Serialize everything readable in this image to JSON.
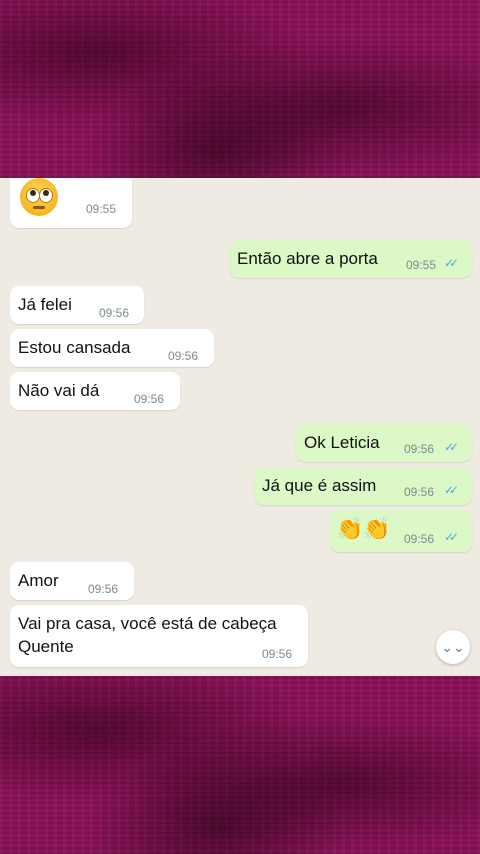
{
  "messages": [
    {
      "dir": "in",
      "text": "",
      "emoji": "rolling-eyes",
      "time": "09:55"
    },
    {
      "dir": "out",
      "text": "Então abre a porta",
      "time": "09:55"
    },
    {
      "dir": "in",
      "text": "Já felei",
      "time": "09:56"
    },
    {
      "dir": "in",
      "text": "Estou cansada",
      "time": "09:56"
    },
    {
      "dir": "in",
      "text": "Não vai dá",
      "time": "09:56"
    },
    {
      "dir": "out",
      "text": "Ok Leticia",
      "time": "09:56"
    },
    {
      "dir": "out",
      "text": "Já que é assim",
      "time": "09:56"
    },
    {
      "dir": "out",
      "text": "👏👏",
      "emoji": "clapping-hands",
      "time": "09:56"
    },
    {
      "dir": "in",
      "text": "Amor",
      "time": "09:56"
    },
    {
      "dir": "in",
      "text_line1": "Vai pra casa, você está de cabeça",
      "text_line2": "Quente",
      "time": "09:56"
    }
  ],
  "read_tick": "✓✓",
  "scroll_button": "⌄⌄",
  "colors": {
    "incoming": "#ffffff",
    "outgoing": "#dcf8c6",
    "tick": "#4fa9e8",
    "chat_bg": "#efeae2",
    "frame": "#8a1258"
  }
}
